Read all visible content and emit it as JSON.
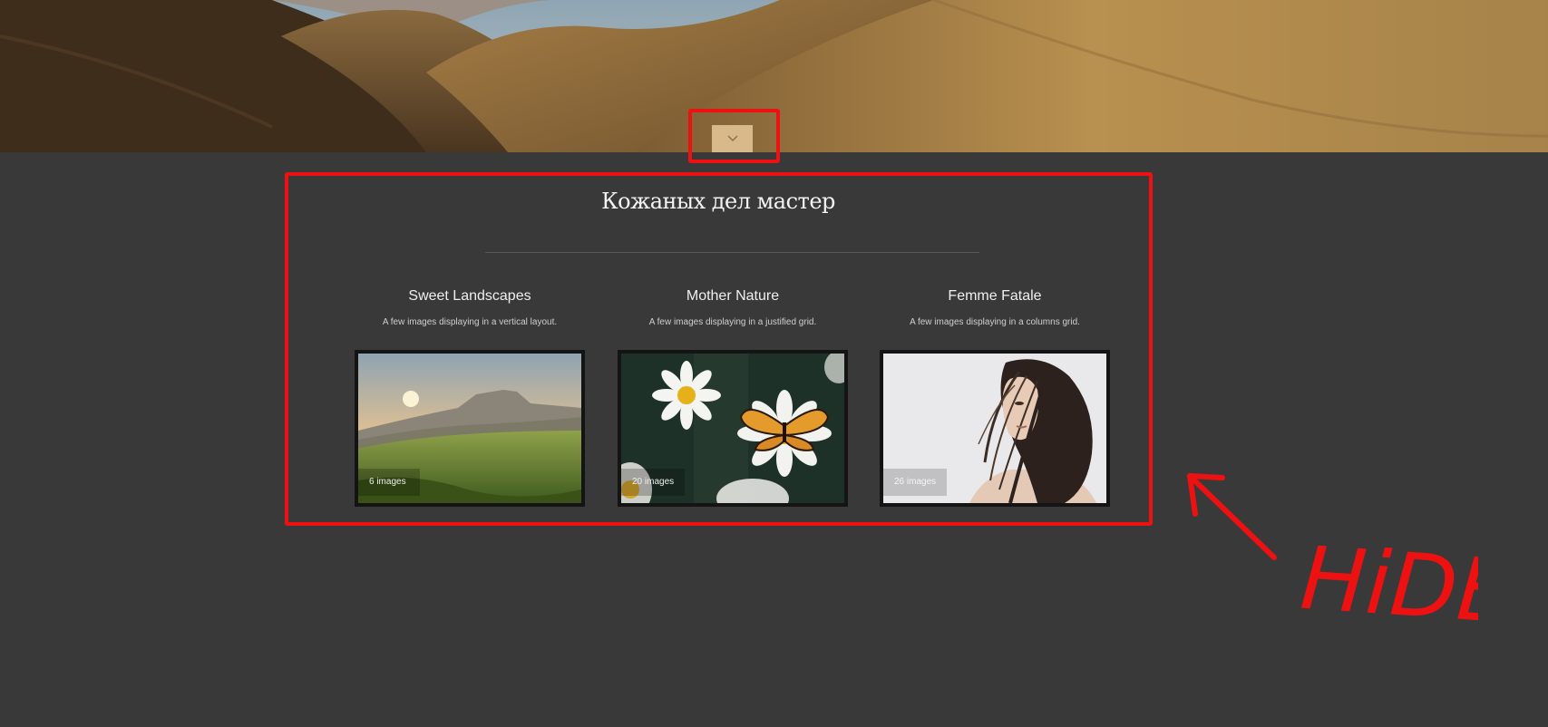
{
  "section": {
    "title": "Кожаных дел мастер"
  },
  "albums": [
    {
      "title": "Sweet Landscapes",
      "description": "A few images displaying in a vertical layout.",
      "count": "6 images"
    },
    {
      "title": "Mother Nature",
      "description": "A few images displaying in a justified grid.",
      "count": "20 images"
    },
    {
      "title": "Femme Fatale",
      "description": "A few images displaying in a columns grid.",
      "count": "26 images"
    }
  ],
  "scroll_button": {
    "icon": "chevron-down-icon"
  },
  "annotation": {
    "text": "HiDE"
  },
  "colors": {
    "background": "#393939",
    "accent_button": "#d7b98a",
    "annotation": "#ee1111"
  }
}
